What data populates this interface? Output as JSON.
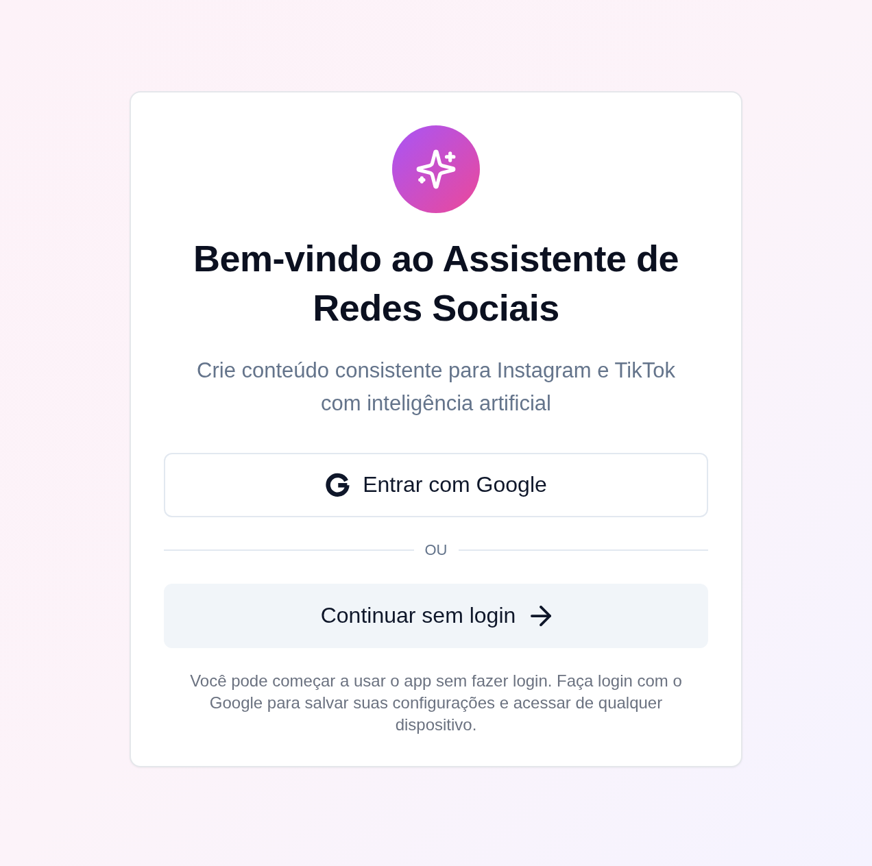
{
  "title": "Bem-vindo ao Assistente de Redes Sociais",
  "subtitle": "Crie conteúdo consistente para Instagram e TikTok com inteligência artificial",
  "google_button": {
    "label": "Entrar com Google"
  },
  "divider": {
    "label": "OU"
  },
  "guest_button": {
    "label": "Continuar sem login"
  },
  "note": "Você pode começar a usar o app sem fazer login. Faça login com o Google para salvar suas configurações e acessar de qualquer dispositivo."
}
